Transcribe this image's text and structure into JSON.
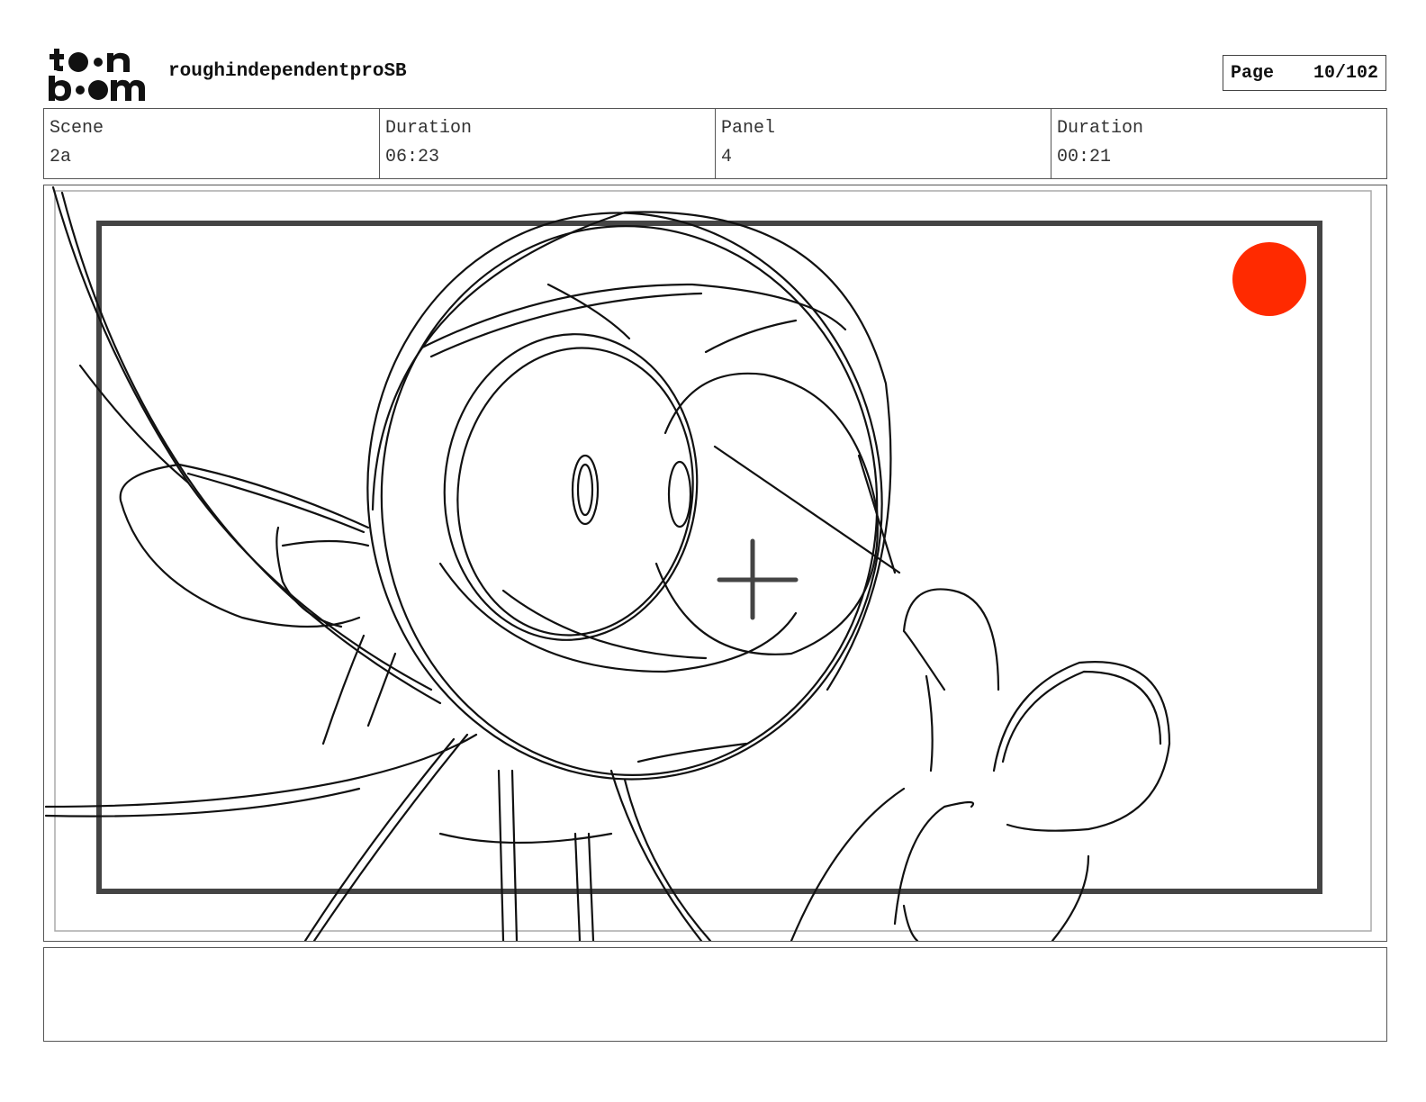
{
  "header": {
    "logo_text_top": "toon",
    "logo_text_bottom": "boom",
    "project_title": "roughindependentproSB",
    "page_label": "Page",
    "page_value": "10/102"
  },
  "info": [
    {
      "label": "Scene",
      "value": "2a"
    },
    {
      "label": "Duration",
      "value": "06:23"
    },
    {
      "label": "Panel",
      "value": "4"
    },
    {
      "label": "Duration",
      "value": "00:21"
    }
  ],
  "panel": {
    "marker_color": "#ff2a00",
    "stroke_color": "#111111"
  },
  "notes": {
    "text": ""
  }
}
